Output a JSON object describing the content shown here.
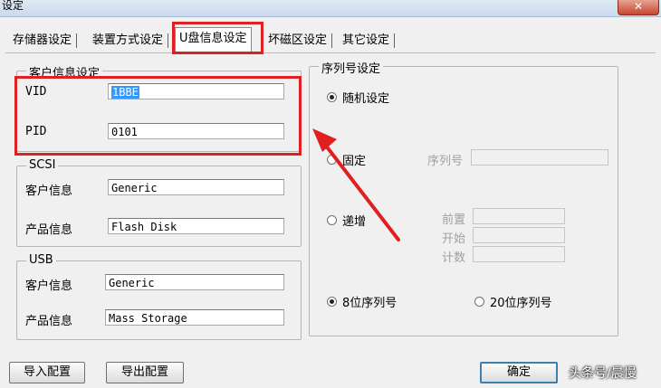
{
  "window": {
    "title": "设定",
    "close_glyph": "✕"
  },
  "tabs": [
    {
      "label": "存储器设定"
    },
    {
      "label": "装置方式设定"
    },
    {
      "label": "U盘信息设定"
    },
    {
      "label": "坏磁区设定"
    },
    {
      "label": "其它设定"
    }
  ],
  "customer_group": {
    "title": "客户信息设定",
    "vid_label": "VID",
    "vid_value": "1BBE",
    "pid_label": "PID",
    "pid_value": "0101"
  },
  "scsi_group": {
    "title": "SCSI",
    "vendor_label": "客户信息",
    "vendor_value": "Generic",
    "product_label": "产品信息",
    "product_value": "Flash Disk"
  },
  "usb_group": {
    "title": "USB",
    "vendor_label": "客户信息",
    "vendor_value": "Generic",
    "product_label": "产品信息",
    "product_value": "Mass Storage"
  },
  "serial_group": {
    "title": "序列号设定",
    "random_label": "随机设定",
    "fixed_label": "固定",
    "serial_label": "序列号",
    "increment_label": "递增",
    "prefix_label": "前置",
    "start_label": "开始",
    "count_label": "计数",
    "len8_label": "8位序列号",
    "len20_label": "20位序列号"
  },
  "footer": {
    "import_label": "导入配置",
    "export_label": "导出配置",
    "ok_label": "确定"
  },
  "watermark": "头条号/晨慢",
  "colors": {
    "highlight": "#e02020",
    "selection": "#3399ff"
  }
}
